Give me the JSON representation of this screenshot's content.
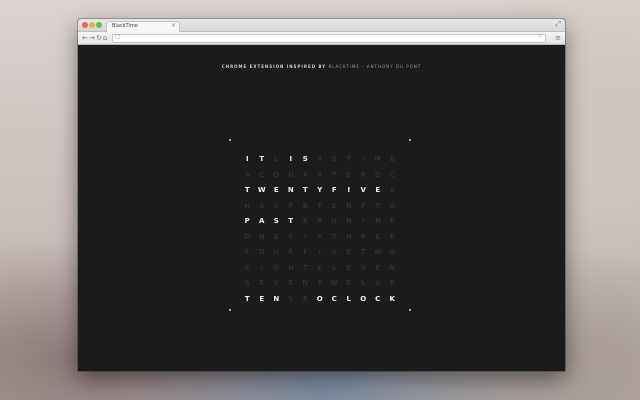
{
  "browser": {
    "tab_title": "BlackTime",
    "tab_close": "×",
    "resize": "⤢",
    "back": "←",
    "forward": "→",
    "reload": "↻",
    "home": "⌂",
    "omnibox_icon": "▢",
    "star": "☆",
    "menu": "≡"
  },
  "page": {
    "credit_label": "CHROME EXTENSION INSPIRED BY",
    "credit_rest": "BLACKTIME - ANTHONY DU PONT"
  },
  "clock": {
    "rows": [
      [
        "I",
        "T",
        "L",
        "I",
        "S",
        "A",
        "S",
        "T",
        "I",
        "M",
        "E"
      ],
      [
        "A",
        "C",
        "Q",
        "U",
        "A",
        "R",
        "T",
        "E",
        "R",
        "D",
        "C"
      ],
      [
        "T",
        "W",
        "E",
        "N",
        "T",
        "Y",
        "F",
        "I",
        "V",
        "E",
        "X"
      ],
      [
        "H",
        "A",
        "L",
        "F",
        "B",
        "T",
        "E",
        "N",
        "F",
        "T",
        "O"
      ],
      [
        "P",
        "A",
        "S",
        "T",
        "E",
        "R",
        "U",
        "N",
        "I",
        "N",
        "E"
      ],
      [
        "O",
        "N",
        "E",
        "S",
        "I",
        "X",
        "T",
        "H",
        "R",
        "E",
        "E"
      ],
      [
        "F",
        "O",
        "U",
        "R",
        "F",
        "I",
        "V",
        "E",
        "T",
        "W",
        "O"
      ],
      [
        "E",
        "I",
        "G",
        "H",
        "T",
        "E",
        "L",
        "E",
        "V",
        "E",
        "N"
      ],
      [
        "S",
        "E",
        "V",
        "E",
        "N",
        "T",
        "W",
        "E",
        "L",
        "V",
        "E"
      ],
      [
        "T",
        "E",
        "N",
        "S",
        "E",
        "O",
        "C",
        "L",
        "O",
        "C",
        "K"
      ]
    ],
    "highlight": [
      [
        1,
        1,
        0,
        1,
        1,
        0,
        0,
        0,
        0,
        0,
        0
      ],
      [
        0,
        0,
        0,
        0,
        0,
        0,
        0,
        0,
        0,
        0,
        0
      ],
      [
        1,
        1,
        1,
        1,
        1,
        1,
        1,
        1,
        1,
        1,
        0
      ],
      [
        0,
        0,
        0,
        0,
        0,
        0,
        0,
        0,
        0,
        0,
        0
      ],
      [
        1,
        1,
        1,
        1,
        0,
        0,
        0,
        0,
        0,
        0,
        0
      ],
      [
        0,
        0,
        0,
        0,
        0,
        0,
        0,
        0,
        0,
        0,
        0
      ],
      [
        0,
        0,
        0,
        0,
        0,
        0,
        0,
        0,
        0,
        0,
        0
      ],
      [
        0,
        0,
        0,
        0,
        0,
        0,
        0,
        0,
        0,
        0,
        0
      ],
      [
        0,
        0,
        0,
        0,
        0,
        0,
        0,
        0,
        0,
        0,
        0
      ],
      [
        1,
        1,
        1,
        0,
        0,
        1,
        1,
        1,
        1,
        1,
        1
      ]
    ],
    "accent_on": "#f2f2f2",
    "accent_off": "#3b3b3b",
    "background": "#1b1b1b"
  }
}
